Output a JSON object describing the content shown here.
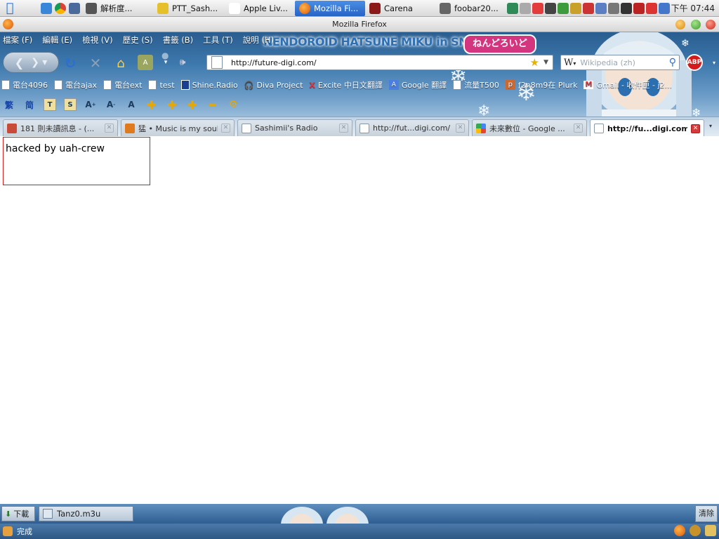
{
  "taskbar": {
    "tasks": [
      {
        "label": "解析度..."
      },
      {
        "label": "PTT_Sash..."
      },
      {
        "label": "Apple Liv..."
      },
      {
        "label": "Mozilla Fi..."
      },
      {
        "label": "Carena"
      },
      {
        "label": "foobar20..."
      }
    ],
    "clock": "下午 07:44"
  },
  "window": {
    "title": "Mozilla Firefox"
  },
  "theme": {
    "banner_text": "NENDOROID HATSUNE MIKU in SNOW",
    "logo_text": "ねんどろいど"
  },
  "menu": {
    "items": [
      "檔案 (F)",
      "編輯 (E)",
      "檢視 (V)",
      "歷史 (S)",
      "書籤 (B)",
      "工具 (T)",
      "說明 (H)"
    ]
  },
  "nav": {
    "url": "http://future-digi.com/",
    "search_placeholder": "Wikipedia (zh)",
    "abp_label": "ABP"
  },
  "bookmarks": [
    {
      "label": "電台4096"
    },
    {
      "label": "電台ajax"
    },
    {
      "label": "電台ext"
    },
    {
      "label": "test"
    },
    {
      "label": "Shine.Radio"
    },
    {
      "label": "Diva Project"
    },
    {
      "label": "Excite 中日文翻譯"
    },
    {
      "label": "Google 翻譯"
    },
    {
      "label": "流量T500"
    },
    {
      "label": "f2n8m9在 Plurk"
    },
    {
      "label": "Gmail - 收件匣 - j2..."
    }
  ],
  "addons": {
    "trad": "繁",
    "simp": "简"
  },
  "tabs": [
    {
      "label": "181 則未讀訊息 - (...",
      "fav_color": "#c84b3a"
    },
    {
      "label": "猛 • Music is my soul.",
      "fav_color": "#e07a1f"
    },
    {
      "label": "Sashimii's Radio",
      "fav_color": "#ffffff"
    },
    {
      "label": "http://fut...digi.com/",
      "fav_color": "#ffffff"
    },
    {
      "label": "未來數位 - Google ...",
      "fav_color": "#3b7de0"
    },
    {
      "label": "http://fu...digi.com/",
      "fav_color": "#ffffff"
    }
  ],
  "content": {
    "message": "hacked by uah-crew"
  },
  "downloads": {
    "button": "下載",
    "item": "Tanz0.m3u",
    "clear": "清除"
  },
  "status": {
    "text": "完成"
  }
}
